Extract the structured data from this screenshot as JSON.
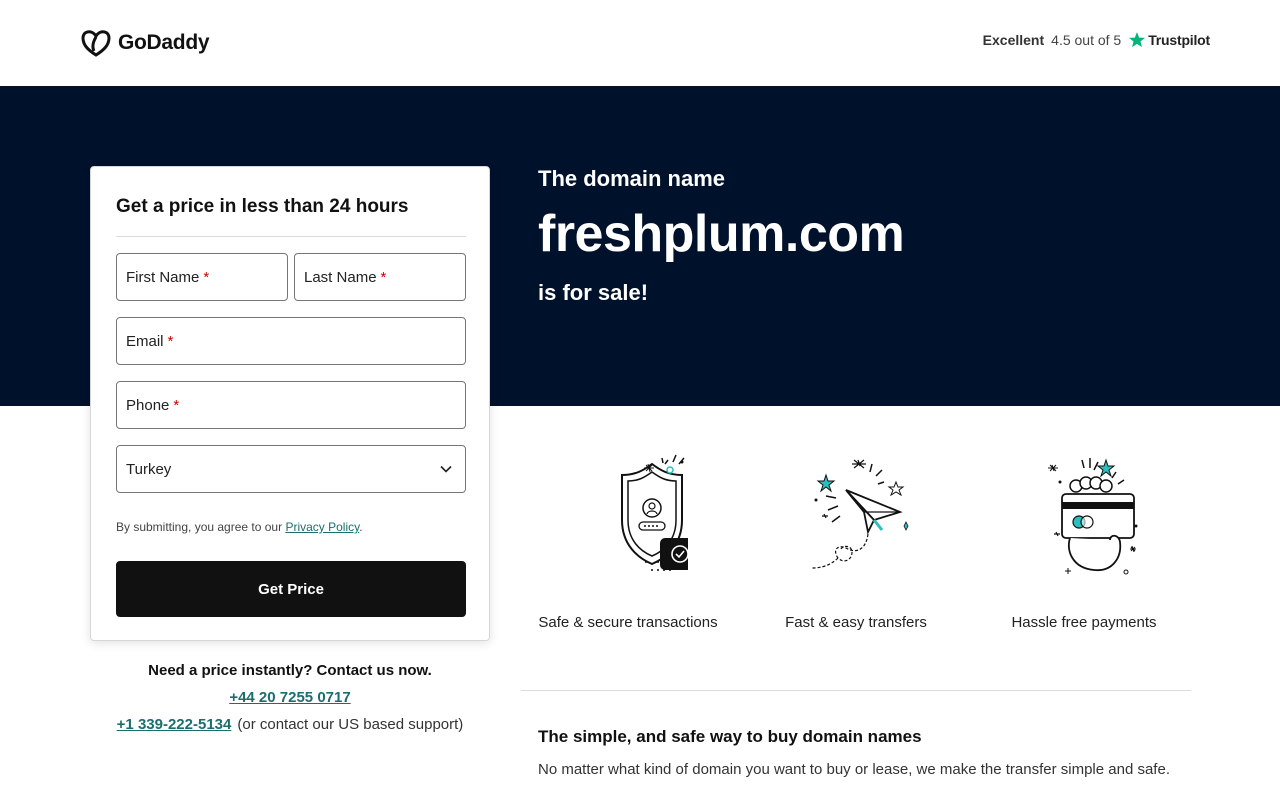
{
  "header": {
    "logo_text": "GoDaddy",
    "trust_rating": "Excellent",
    "trust_score": "4.5 out of 5",
    "trust_brand": "Trustpilot"
  },
  "hero": {
    "line1": "The domain name",
    "domain": "freshplum.com",
    "line3": "is for sale!"
  },
  "form": {
    "title": "Get a price in less than 24 hours",
    "first_name_label": "First Name",
    "last_name_label": "Last Name",
    "email_label": "Email",
    "phone_label": "Phone",
    "country_value": "Turkey",
    "required_mark": "*",
    "consent_text": "By submitting, you agree to our ",
    "privacy_link": "Privacy Policy",
    "consent_end": ".",
    "submit_label": "Get Price"
  },
  "contact": {
    "heading": "Need a price instantly? Contact us now.",
    "phone_uk": "+44 20 7255 0717",
    "phone_us": "+1 339-222-5134",
    "phone_us_note": "(or contact our US based support)"
  },
  "features": [
    {
      "label": "Safe & secure transactions",
      "icon": "shield-icon"
    },
    {
      "label": "Fast & easy transfers",
      "icon": "paper-plane-icon"
    },
    {
      "label": "Hassle free payments",
      "icon": "card-payment-icon"
    }
  ],
  "section": {
    "title": "The simple, and safe way to buy domain names",
    "body": "No matter what kind of domain you want to buy or lease, we make the transfer simple and safe."
  },
  "colors": {
    "hero_bg": "#00112c",
    "accent_teal": "#1a6e6e",
    "icon_teal": "#2bbfbf",
    "trustpilot_green": "#00b67a",
    "button_bg": "#111111"
  }
}
